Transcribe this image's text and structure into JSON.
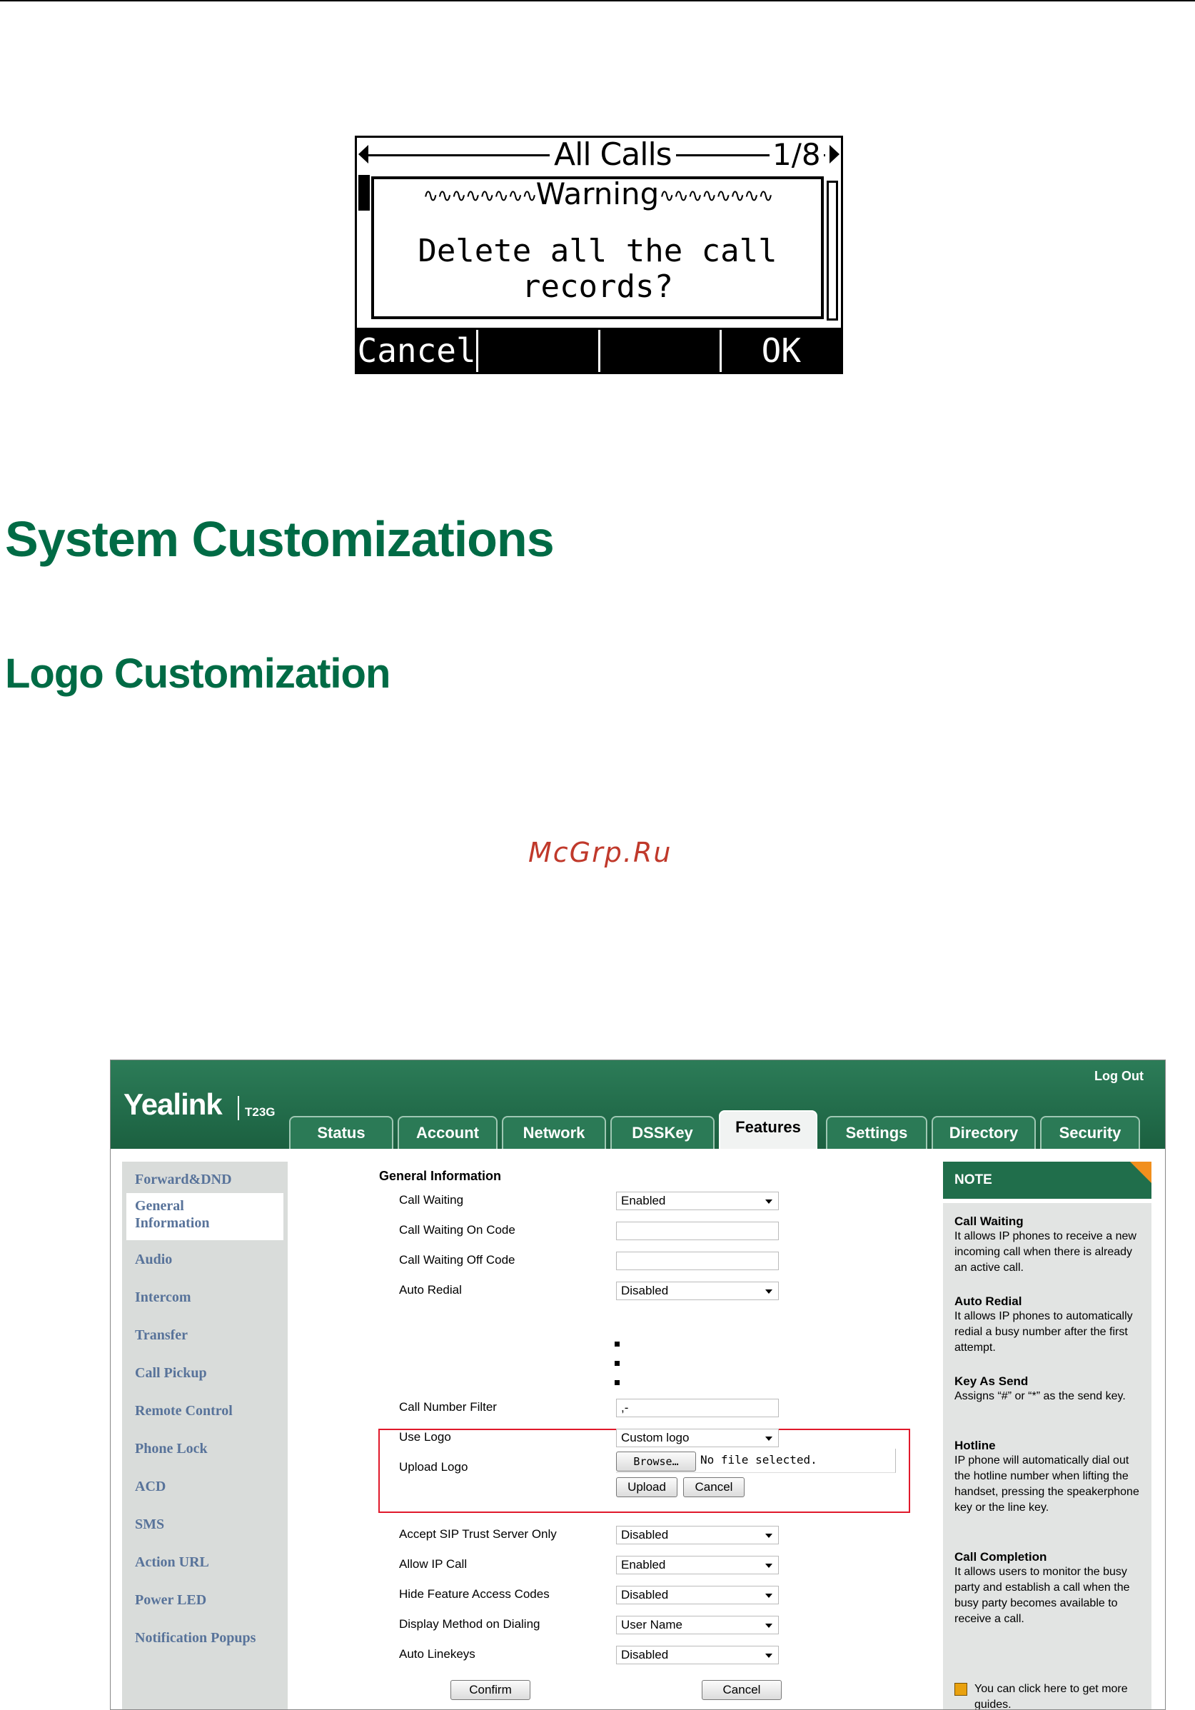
{
  "lcd": {
    "title": "All Calls",
    "page": "1/8",
    "dialog_title": "Warning",
    "message": "Delete all the call records?",
    "softkeys": [
      "Cancel",
      "",
      "",
      "OK"
    ]
  },
  "headings": {
    "h1": "System Customizations",
    "h2": "Logo Customization"
  },
  "watermark": "McGrp.Ru",
  "web": {
    "logo": "Yealink",
    "model": "T23G",
    "logout": "Log Out",
    "tabs": [
      "Status",
      "Account",
      "Network",
      "DSSKey",
      "Features",
      "Settings",
      "Directory",
      "Security"
    ],
    "active_tab": "Features",
    "sidebar": [
      "Forward&DND",
      "General Information",
      "Audio",
      "Intercom",
      "Transfer",
      "Call Pickup",
      "Remote Control",
      "Phone Lock",
      "ACD",
      "SMS",
      "Action URL",
      "Power LED",
      "Notification Popups"
    ],
    "section_title": "General Information",
    "fields": {
      "call_waiting": {
        "label": "Call Waiting",
        "value": "Enabled"
      },
      "cw_on_code": {
        "label": "Call Waiting On Code",
        "value": ""
      },
      "cw_off_code": {
        "label": "Call Waiting Off Code",
        "value": ""
      },
      "auto_redial": {
        "label": "Auto Redial",
        "value": "Disabled"
      },
      "call_number_filter": {
        "label": "Call Number Filter",
        "value": ",-"
      },
      "use_logo": {
        "label": "Use Logo",
        "value": "Custom logo"
      },
      "upload_logo": {
        "label": "Upload Logo",
        "browse": "Browse…",
        "no_file": "No file selected."
      },
      "accept_sip": {
        "label": "Accept SIP Trust Server Only",
        "value": "Disabled"
      },
      "allow_ip_call": {
        "label": "Allow IP Call",
        "value": "Enabled"
      },
      "hide_fac": {
        "label": "Hide Feature Access Codes",
        "value": "Disabled"
      },
      "display_method": {
        "label": "Display Method on Dialing",
        "value": "User Name"
      },
      "auto_linekeys": {
        "label": "Auto Linekeys",
        "value": "Disabled"
      }
    },
    "buttons": {
      "upload": "Upload",
      "cancel_small": "Cancel",
      "confirm": "Confirm",
      "cancel": "Cancel"
    },
    "note": {
      "header": "NOTE",
      "items": [
        {
          "title": "Call Waiting",
          "text": "It allows IP phones to receive a new incoming call when there is already an active call."
        },
        {
          "title": "Auto Redial",
          "text": "It allows IP phones to automatically redial a busy number after the first attempt."
        },
        {
          "title": "Key As Send",
          "text": "Assigns “#” or “*” as the send key."
        },
        {
          "title": "Hotline",
          "text": "IP phone will automatically dial out the hotline number when lifting the handset, pressing the speakerphone key or the line key."
        },
        {
          "title": "Call Completion",
          "text": "It allows users to monitor the busy party and establish a call when the busy party becomes available to receive a call."
        }
      ],
      "guide": "You can click here to get more guides."
    }
  }
}
